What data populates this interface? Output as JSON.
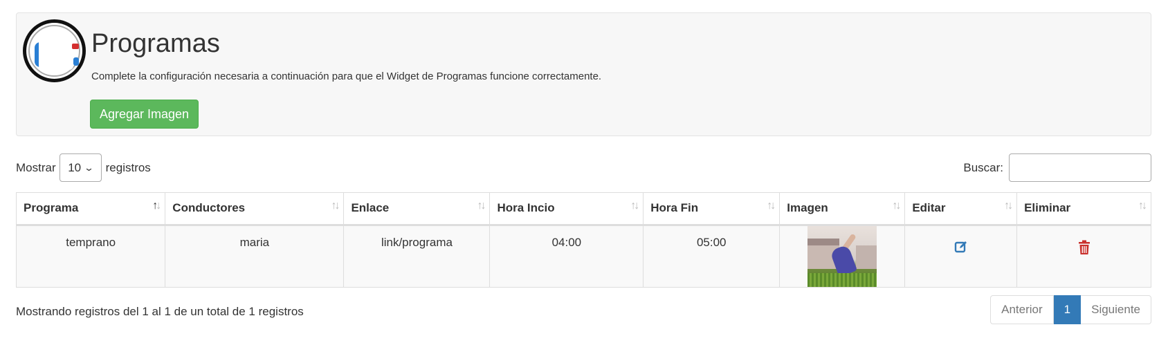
{
  "header": {
    "title": "Programas",
    "subtitle": "Complete la configuración necesaria a continuación para que el Widget de Programas funcione correctamente.",
    "add_button_label": "Agregar Imagen"
  },
  "controls": {
    "show_label": "Mostrar",
    "page_length": "10",
    "records_label": "registros",
    "search_label": "Buscar:",
    "search_value": ""
  },
  "table": {
    "columns": [
      "Programa",
      "Conductores",
      "Enlace",
      "Hora Incio",
      "Hora Fin",
      "Imagen",
      "Editar",
      "Eliminar"
    ],
    "sorted_column": "Programa",
    "rows": [
      {
        "programa": "temprano",
        "conductores": "maria",
        "enlace": "link/programa",
        "hora_inicio": "04:00",
        "hora_fin": "05:00",
        "imagen": "program-thumbnail",
        "editar_icon": "edit-icon",
        "eliminar_icon": "trash-icon"
      }
    ]
  },
  "footer": {
    "info": "Mostrando registros del 1 al 1 de un total de 1 registros",
    "pagination": {
      "previous": "Anterior",
      "current": "1",
      "next": "Siguiente"
    }
  },
  "colors": {
    "success": "#5cb85c",
    "primary": "#337ab7",
    "edit_icon": "#337ab7",
    "delete_icon": "#c9302c",
    "panel_bg": "#f7f7f7"
  }
}
